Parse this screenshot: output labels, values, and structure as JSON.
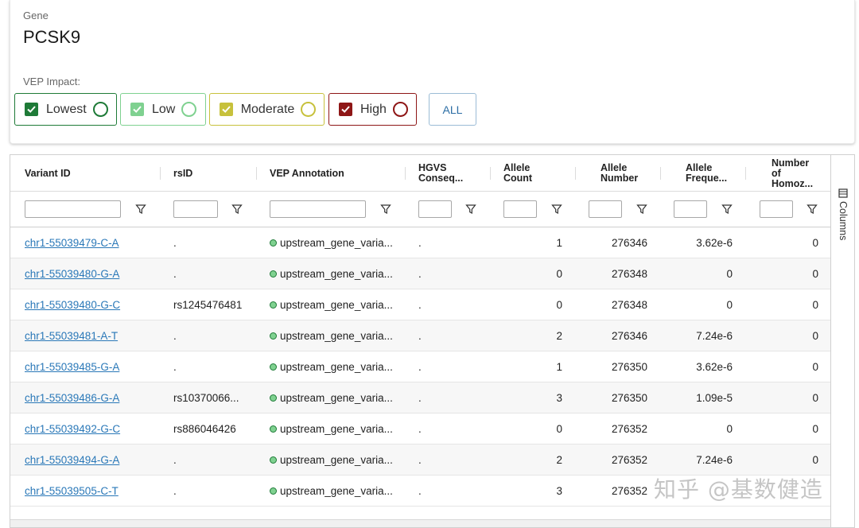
{
  "gene": {
    "label": "Gene",
    "value": "PCSK9"
  },
  "vep": {
    "label": "VEP Impact:",
    "chips": [
      {
        "label": "Lowest",
        "color": "#1e7a37",
        "checked": true
      },
      {
        "label": "Low",
        "color": "#7fd190",
        "checked": true
      },
      {
        "label": "Moderate",
        "color": "#c7c13c",
        "checked": true
      },
      {
        "label": "High",
        "color": "#8e1616",
        "checked": true
      }
    ],
    "all_button": "ALL"
  },
  "grid": {
    "columns": [
      {
        "key": "variant_id",
        "label": "Variant ID"
      },
      {
        "key": "rsid",
        "label": "rsID"
      },
      {
        "key": "vep",
        "label": "VEP Annotation"
      },
      {
        "key": "hgvs",
        "label": "HGVS Conseq..."
      },
      {
        "key": "allele_count",
        "label": "Allele Count"
      },
      {
        "key": "allele_number",
        "label": "Allele Number"
      },
      {
        "key": "allele_freq",
        "label": "Allele Freque..."
      },
      {
        "key": "homoz",
        "label": "Number of Homoz..."
      }
    ],
    "header_lines": {
      "hgvs": [
        "HGVS",
        "Conseq..."
      ],
      "allele_count": [
        "Allele",
        "Count"
      ],
      "allele_number": [
        "Allele",
        "Number"
      ],
      "allele_freq": [
        "Allele",
        "Freque..."
      ],
      "homoz": [
        "Number",
        "of",
        "Homoz..."
      ]
    },
    "rows": [
      {
        "variant_id": "chr1-55039479-C-A",
        "rsid": ".",
        "vep": "upstream_gene_varia...",
        "hgvs": ".",
        "allele_count": "1",
        "allele_number": "276346",
        "allele_freq": "3.62e-6",
        "homoz": "0"
      },
      {
        "variant_id": "chr1-55039480-G-A",
        "rsid": ".",
        "vep": "upstream_gene_varia...",
        "hgvs": ".",
        "allele_count": "0",
        "allele_number": "276348",
        "allele_freq": "0",
        "homoz": "0"
      },
      {
        "variant_id": "chr1-55039480-G-C",
        "rsid": "rs1245476481",
        "vep": "upstream_gene_varia...",
        "hgvs": ".",
        "allele_count": "0",
        "allele_number": "276348",
        "allele_freq": "0",
        "homoz": "0"
      },
      {
        "variant_id": "chr1-55039481-A-T",
        "rsid": ".",
        "vep": "upstream_gene_varia...",
        "hgvs": ".",
        "allele_count": "2",
        "allele_number": "276346",
        "allele_freq": "7.24e-6",
        "homoz": "0"
      },
      {
        "variant_id": "chr1-55039485-G-A",
        "rsid": ".",
        "vep": "upstream_gene_varia...",
        "hgvs": ".",
        "allele_count": "1",
        "allele_number": "276350",
        "allele_freq": "3.62e-6",
        "homoz": "0"
      },
      {
        "variant_id": "chr1-55039486-G-A",
        "rsid": "rs10370066...",
        "vep": "upstream_gene_varia...",
        "hgvs": ".",
        "allele_count": "3",
        "allele_number": "276350",
        "allele_freq": "1.09e-5",
        "homoz": "0"
      },
      {
        "variant_id": "chr1-55039492-G-C",
        "rsid": "rs886046426",
        "vep": "upstream_gene_varia...",
        "hgvs": ".",
        "allele_count": "0",
        "allele_number": "276352",
        "allele_freq": "0",
        "homoz": "0"
      },
      {
        "variant_id": "chr1-55039494-G-A",
        "rsid": ".",
        "vep": "upstream_gene_varia...",
        "hgvs": ".",
        "allele_count": "2",
        "allele_number": "276352",
        "allele_freq": "7.24e-6",
        "homoz": "0"
      },
      {
        "variant_id": "chr1-55039505-C-T",
        "rsid": ".",
        "vep": "upstream_gene_varia...",
        "hgvs": ".",
        "allele_count": "3",
        "allele_number": "276352",
        "allele_freq": "",
        "homoz": ""
      }
    ],
    "vep_dot_color": "#7fd190"
  },
  "side_panel": {
    "columns_label": "Columns",
    "icon": "columns-icon"
  },
  "watermark": "知乎 @基数健造"
}
